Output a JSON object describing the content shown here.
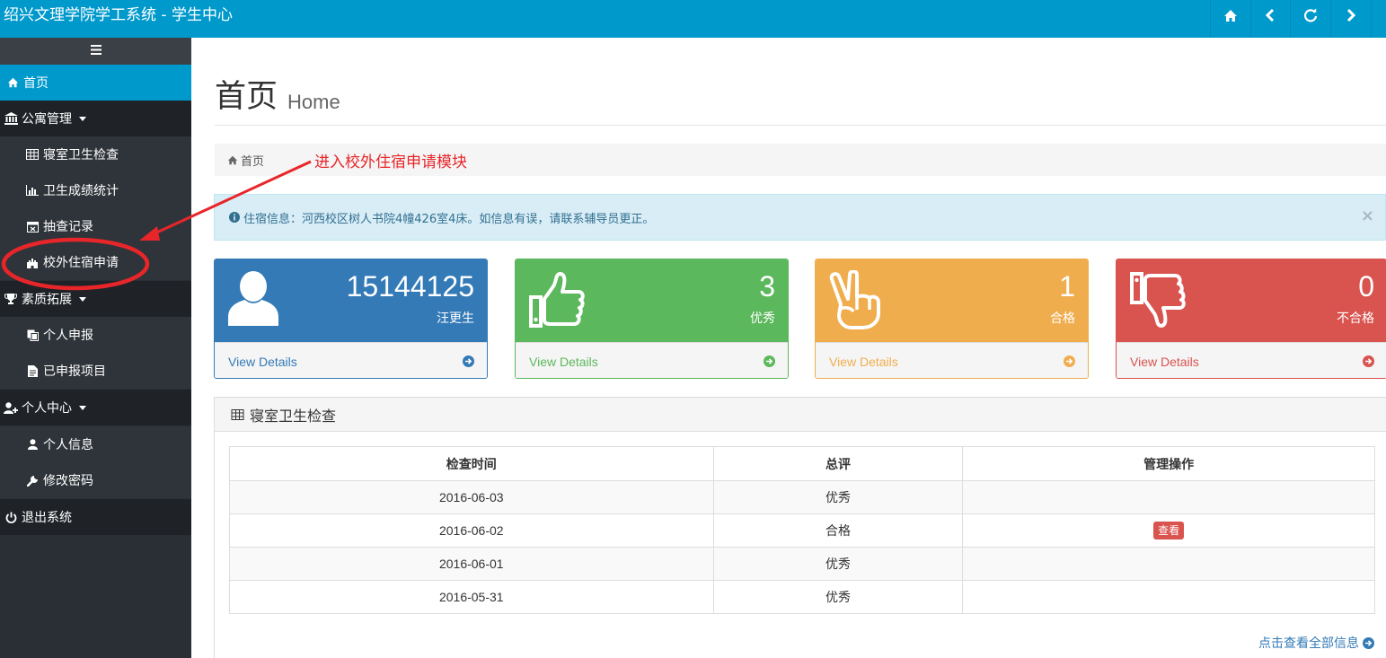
{
  "app": {
    "title": "绍兴文理学院学工系统 - 学生中心"
  },
  "topbar": {
    "buttons": [
      {
        "icon": "home-icon"
      },
      {
        "icon": "chevron-left-icon"
      },
      {
        "icon": "refresh-icon"
      },
      {
        "icon": "chevron-right-icon"
      }
    ]
  },
  "sidebar": {
    "toggle_icon": "menu-icon",
    "items": [
      {
        "label": "首页",
        "icon": "home-icon",
        "active": true
      },
      {
        "label": "公寓管理",
        "icon": "bank-icon",
        "expandable": true
      },
      {
        "label": "寝室卫生检查",
        "icon": "table-icon"
      },
      {
        "label": "卫生成绩统计",
        "icon": "bar-chart-icon"
      },
      {
        "label": "抽查记录",
        "icon": "calendar-x-icon"
      },
      {
        "label": "校外住宿申请",
        "icon": "castle-icon"
      },
      {
        "label": "素质拓展",
        "icon": "trophy-icon",
        "expandable": true
      },
      {
        "label": "个人申报",
        "icon": "copy-icon"
      },
      {
        "label": "已申报项目",
        "icon": "file-icon"
      },
      {
        "label": "个人中心",
        "icon": "user-plus-icon",
        "expandable": true
      },
      {
        "label": "个人信息",
        "icon": "user-icon"
      },
      {
        "label": "修改密码",
        "icon": "wrench-icon"
      },
      {
        "label": "退出系统",
        "icon": "power-icon"
      }
    ]
  },
  "page": {
    "title": "首页",
    "subtitle": "Home"
  },
  "breadcrumb": {
    "home_label": "首页"
  },
  "annotation": {
    "text": "进入校外住宿申请模块"
  },
  "alert": {
    "text": "住宿信息：河西校区树人书院4幢426室4床。如信息有误，请联系辅导员更正。",
    "close": "×"
  },
  "cards": [
    {
      "value": "15144125",
      "label": "汪更生",
      "footer": "View Details",
      "icon": "user-icon",
      "color": "#337ab7"
    },
    {
      "value": "3",
      "label": "优秀",
      "footer": "View Details",
      "icon": "thumbs-up-icon",
      "color": "#5cb85c"
    },
    {
      "value": "1",
      "label": "合格",
      "footer": "View Details",
      "icon": "hand-peace-icon",
      "color": "#f0ad4e"
    },
    {
      "value": "0",
      "label": "不合格",
      "footer": "View Details",
      "icon": "thumbs-down-icon",
      "color": "#d9534f"
    }
  ],
  "panel": {
    "title": "寝室卫生检查",
    "columns": [
      "检查时间",
      "总评",
      "管理操作"
    ],
    "rows": [
      {
        "date": "2016-06-03",
        "grade": "优秀",
        "action": ""
      },
      {
        "date": "2016-06-02",
        "grade": "合格",
        "action": "查看"
      },
      {
        "date": "2016-06-01",
        "grade": "优秀",
        "action": ""
      },
      {
        "date": "2016-05-31",
        "grade": "优秀",
        "action": ""
      }
    ],
    "more_link": "点击查看全部信息"
  }
}
